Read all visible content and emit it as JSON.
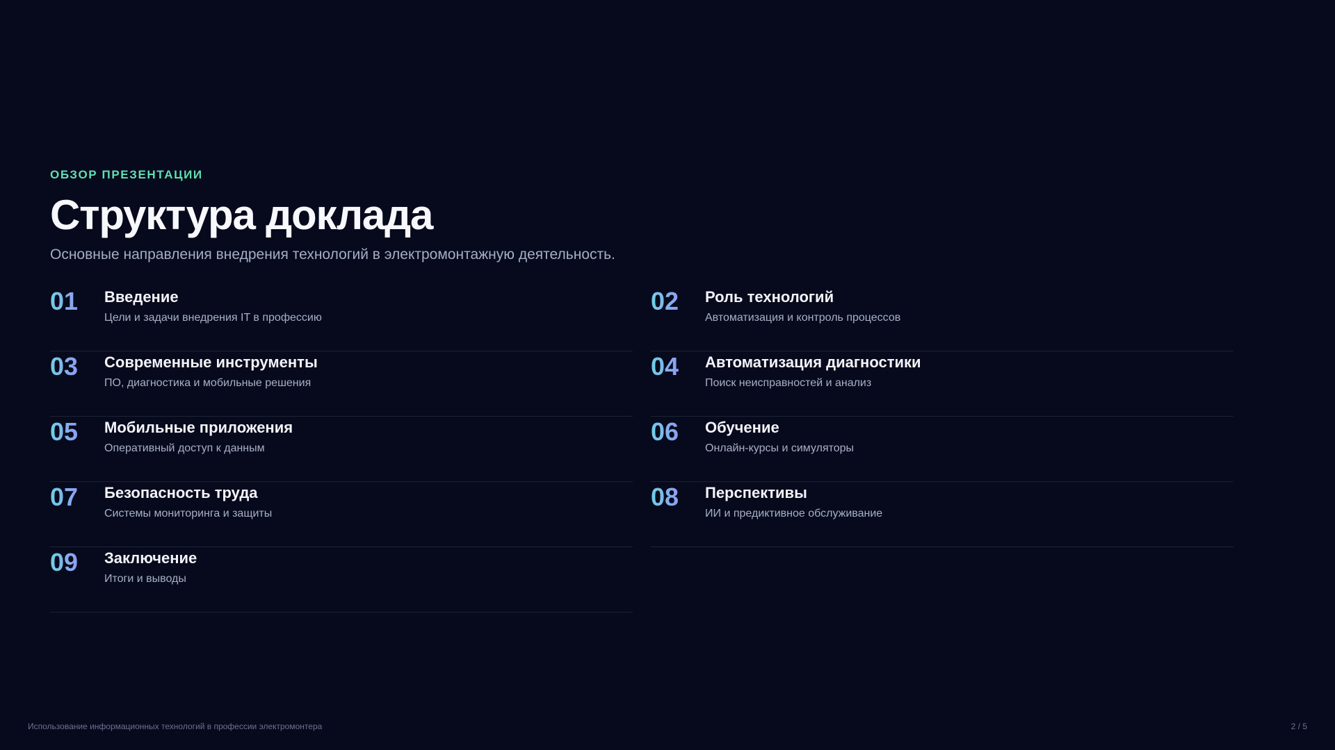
{
  "header": {
    "eyebrow": "ОБЗОР ПРЕЗЕНТАЦИИ",
    "title": "Структура доклада",
    "subtitle": "Основные направления внедрения технологий в электромонтажную деятельность."
  },
  "items": [
    {
      "number": "01",
      "title": "Введение",
      "description": "Цели и задачи внедрения IT в профессию"
    },
    {
      "number": "02",
      "title": "Роль технологий",
      "description": "Автоматизация и контроль процессов"
    },
    {
      "number": "03",
      "title": "Современные инструменты",
      "description": "ПО, диагностика и мобильные решения"
    },
    {
      "number": "04",
      "title": "Автоматизация диагностики",
      "description": "Поиск неисправностей и анализ"
    },
    {
      "number": "05",
      "title": "Мобильные приложения",
      "description": "Оперативный доступ к данным"
    },
    {
      "number": "06",
      "title": "Обучение",
      "description": "Онлайн-курсы и симуляторы"
    },
    {
      "number": "07",
      "title": "Безопасность труда",
      "description": "Системы мониторинга и защиты"
    },
    {
      "number": "08",
      "title": "Перспективы",
      "description": "ИИ и предиктивное обслуживание"
    },
    {
      "number": "09",
      "title": "Заключение",
      "description": "Итоги и выводы"
    }
  ],
  "footer": {
    "presentation_title": "Использование информационных технологий в профессии электромонтера",
    "page_indicator": "2 / 5"
  },
  "colors": {
    "background": "#070a1d",
    "accent": "#5fe0b0",
    "number_gradient_start": "#6fd0e6",
    "number_gradient_end": "#8f9cf2"
  }
}
